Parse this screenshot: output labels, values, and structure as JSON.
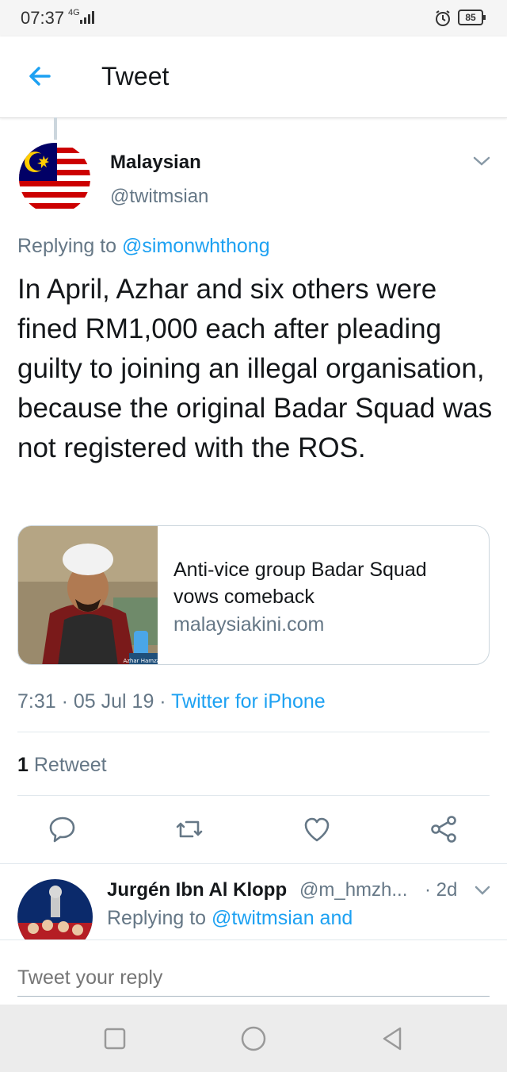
{
  "status": {
    "time": "07:37",
    "network": "4G",
    "battery": "85"
  },
  "header": {
    "title": "Tweet"
  },
  "tweet": {
    "author_name": "Malaysian",
    "author_handle": "@twitmsian",
    "replying_prefix": "Replying to",
    "replying_to": "@simonwhthong",
    "text": "In April, Azhar and six others were fined RM1,000 each after pleading guilty to joining an illegal organisation, because the original Badar Squad was not registered with the ROS.",
    "card": {
      "title": "Anti-vice group Badar Squad vows comeback",
      "domain": "malaysiakini.com",
      "image_caption": "Azhar Hamzah"
    },
    "time": "7:31",
    "date": "05 Jul 19",
    "source": "Twitter for iPhone",
    "retweet_count": "1",
    "retweet_label": "Retweet"
  },
  "reply": {
    "name": "Jurgén Ibn Al Klopp",
    "handle": "@m_hmzh...",
    "time": "· 2d",
    "replying_prefix": "Replying to",
    "replying_to": "@twitmsian and"
  },
  "compose": {
    "placeholder": "Tweet your reply"
  },
  "colors": {
    "accent": "#1da1f2",
    "muted": "#657786",
    "text": "#14171a"
  }
}
